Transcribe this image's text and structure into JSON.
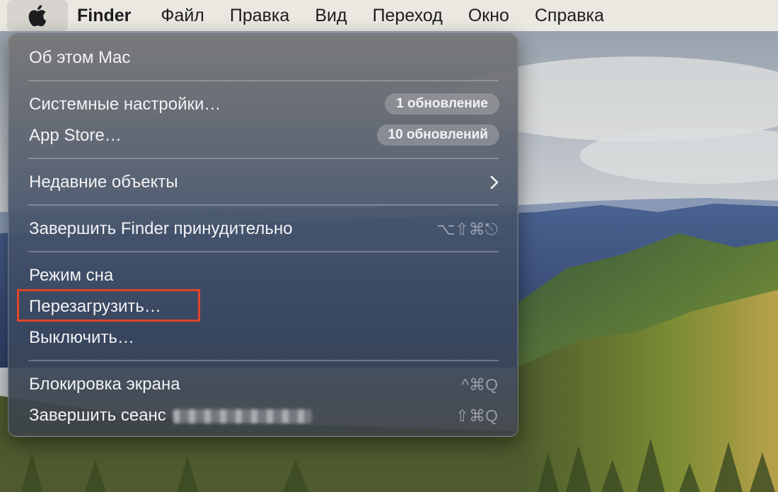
{
  "menubar": {
    "apple_icon": "apple-logo-icon",
    "app_name": "Finder",
    "items": [
      "Файл",
      "Правка",
      "Вид",
      "Переход",
      "Окно",
      "Справка"
    ]
  },
  "apple_menu": {
    "about": "Об этом Mac",
    "system_settings": "Системные настройки…",
    "system_settings_badge": "1 обновление",
    "app_store": "App Store…",
    "app_store_badge": "10 обновлений",
    "recent_items": "Недавние объекты",
    "force_quit": "Завершить Finder принудительно",
    "force_quit_shortcut": "⌥⇧⌘⎋",
    "sleep": "Режим сна",
    "restart": "Перезагрузить…",
    "shutdown": "Выключить…",
    "lock_screen": "Блокировка экрана",
    "lock_screen_shortcut": "^⌘Q",
    "log_out": "Завершить сеанс",
    "log_out_shortcut": "⇧⌘Q"
  },
  "colors": {
    "menubar_bg": "#ebe8e2",
    "annotation_red": "#e0442b"
  }
}
